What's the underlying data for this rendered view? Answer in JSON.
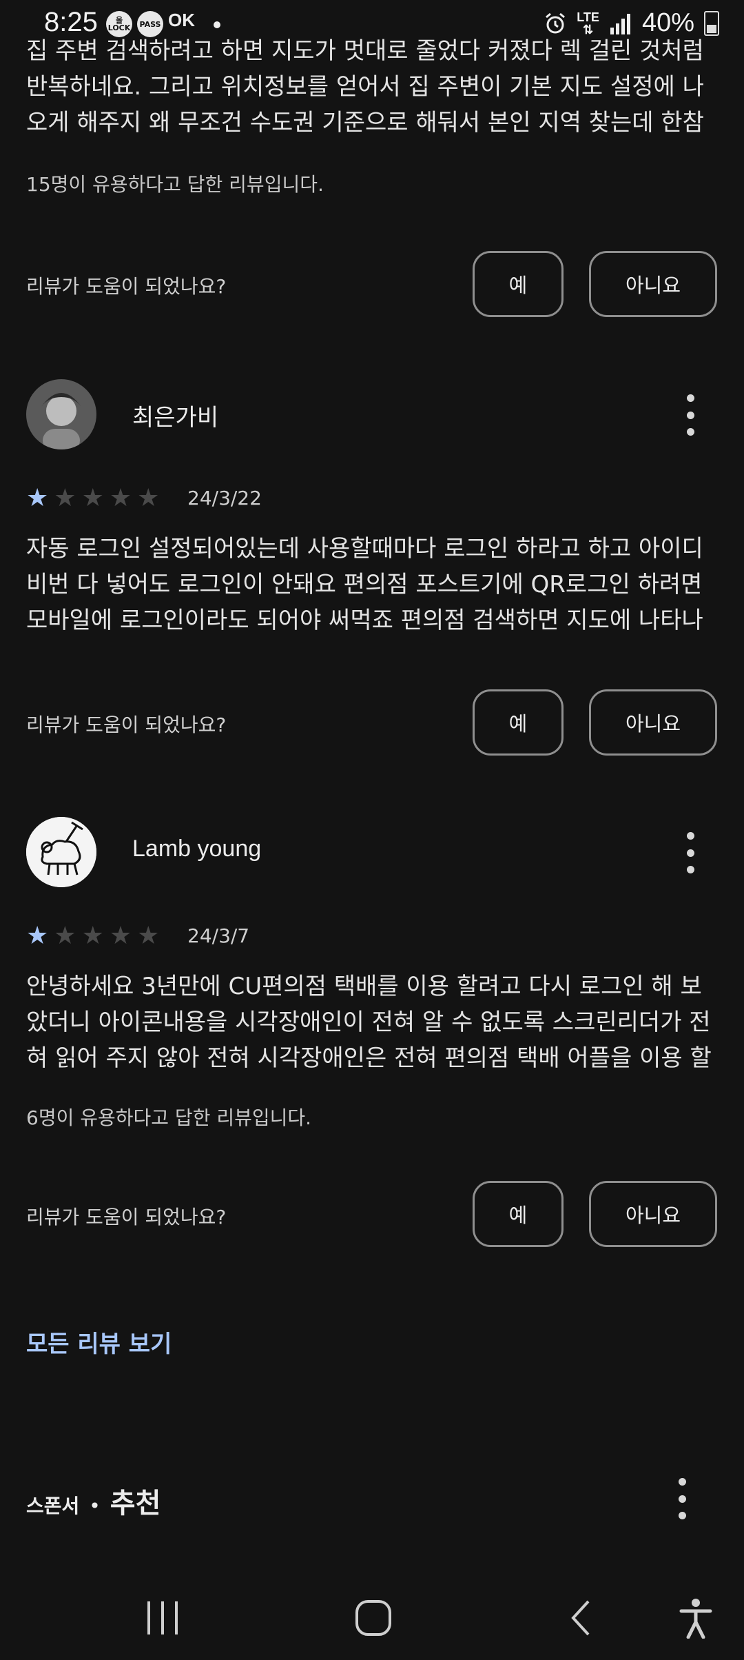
{
  "status_bar": {
    "time": "8:25",
    "icons": [
      "ollock-icon",
      "pass-icon",
      "ok-icon",
      "dot-icon",
      "alarm-icon",
      "lte-icon",
      "signal-icon",
      "battery-icon"
    ],
    "lock_label": "올LOCK",
    "pass_label": "PASS",
    "ok_label": "OK",
    "lte_label": "LTE",
    "battery": "40%"
  },
  "top_review": {
    "text": "집 주변 검색하려고 하면 지도가 멋대로 줄었다 커졌다 렉 걸린 것처럼 반복하네요. 그리고 위치정보를 얻어서 집 주변이 기본 지도 설정에 나오게 해주지 왜 무조건 수도권 기준으로 해둬서 본인 지역 찾는데 한참 걸리...",
    "helpful_count": "15명이 유용하다고 답한 리뷰입니다.",
    "helpful_question": "리뷰가 도움이 되었나요?",
    "yes": "예",
    "no": "아니요"
  },
  "reviews": [
    {
      "author": "최은가비",
      "rating": 1,
      "max_rating": 5,
      "date": "24/3/22",
      "text": "자동 로그인 설정되어있는데 사용할때마다 로그인 하라고 하고 아이디 비번 다 넣어도 로그인이 안돼요 편의점 포스트기에 QR로그인 하려면 모바일에 로그인이라도 되어야 써먹죠 편의점 검색하면 지도에 나타나지오 ...",
      "helpful_question": "리뷰가 도움이 되었나요?",
      "yes": "예",
      "no": "아니요"
    },
    {
      "author": "Lamb young",
      "rating": 1,
      "max_rating": 5,
      "date": "24/3/7",
      "text": "안녕하세요 3년만에 CU편의점 택배를 이용 할려고 다시 로그인 해 보았더니 아이콘내용을 시각장애인이 전혀 알 수 없도록 스크린리더가 전혀 읽어 주지 않아 전혀 시각장애인은 전혀 편의점 택배 어플을 이용 할수...",
      "helpful_count": "6명이 유용하다고 답한 리뷰입니다.",
      "helpful_question": "리뷰가 도움이 되었나요?",
      "yes": "예",
      "no": "아니요"
    }
  ],
  "all_reviews_link": "모든 리뷰 보기",
  "sponsor": {
    "label": "스폰서",
    "separator": "•",
    "title": "추천"
  },
  "nav": [
    "recent-apps-icon",
    "home-icon",
    "back-icon",
    "accessibility-icon"
  ],
  "colors": {
    "background": "#131313",
    "accent": "#a8c7fa",
    "star_empty": "#4a4a4a",
    "button_border": "#8f8f8f"
  }
}
